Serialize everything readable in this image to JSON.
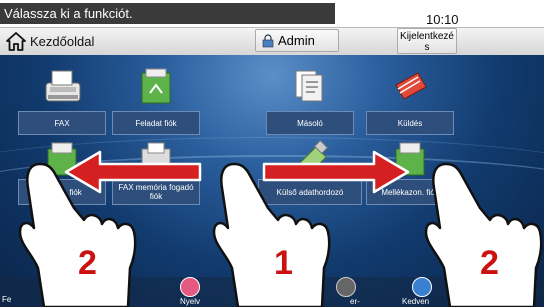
{
  "status": {
    "message": "Válassza ki a funkciót.",
    "time": "10:10"
  },
  "header": {
    "home_label": "Kezdőoldal",
    "admin_label": "Admin",
    "logout_label": "Kijelentkezés"
  },
  "tiles": {
    "fax": "FAX",
    "job_box": "Feladat fiók",
    "copy": "Másoló",
    "send": "Küldés",
    "custom_box": "Egyéd. fiók",
    "fax_memory": "FAX memória fogadó fiók",
    "external_media": "Külső adathordozó",
    "attachment_box": "Mellékazon. fiók"
  },
  "bottom": {
    "language": "Nyelv",
    "left_partial": "Fe",
    "right_partial": "Kedven",
    "mid_partial": "er-"
  },
  "gesture_numbers": {
    "left": "2",
    "center": "1",
    "right": "2"
  },
  "colors": {
    "arrow": "#d42020",
    "number": "#cc1111",
    "background": "#113a6d"
  }
}
